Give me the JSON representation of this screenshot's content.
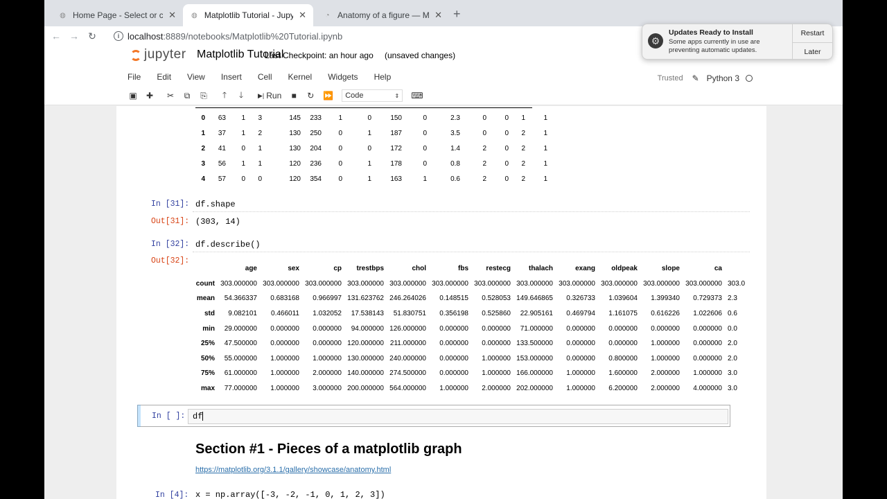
{
  "browser": {
    "tabs": [
      {
        "label": "Home Page - Select or create",
        "favicon": "jupyter-favicon"
      },
      {
        "label": "Matplotlib Tutorial - Jupyter N",
        "favicon": "jupyter-favicon"
      },
      {
        "label": "Anatomy of a figure — Matplo",
        "favicon": "matplotlib-favicon"
      }
    ],
    "new_tab": "+",
    "close_glyph": "✕",
    "url_host": "localhost",
    "url_rest": ":8889/notebooks/Matplotlib%20Tutorial.ipynb"
  },
  "jupyter": {
    "logo_text": "jupyter",
    "title": "Matplotlib Tutorial",
    "checkpoint": "Last Checkpoint: an hour ago",
    "unsaved": "(unsaved changes)",
    "menu": [
      "File",
      "Edit",
      "View",
      "Insert",
      "Cell",
      "Kernel",
      "Widgets",
      "Help"
    ],
    "trusted": "Trusted",
    "kernel": "Python 3",
    "run_label": "Run",
    "cell_type": "Code"
  },
  "notification": {
    "title": "Updates Ready to Install",
    "body": "Some apps currently in use are preventing automatic updates.",
    "restart": "Restart",
    "later": "Later"
  },
  "cells": {
    "head_table": {
      "rows": [
        [
          "0",
          "63",
          "1",
          "3",
          "145",
          "233",
          "1",
          "0",
          "150",
          "0",
          "2.3",
          "0",
          "0",
          "1",
          "1"
        ],
        [
          "1",
          "37",
          "1",
          "2",
          "130",
          "250",
          "0",
          "1",
          "187",
          "0",
          "3.5",
          "0",
          "0",
          "2",
          "1"
        ],
        [
          "2",
          "41",
          "0",
          "1",
          "130",
          "204",
          "0",
          "0",
          "172",
          "0",
          "1.4",
          "2",
          "0",
          "2",
          "1"
        ],
        [
          "3",
          "56",
          "1",
          "1",
          "120",
          "236",
          "0",
          "1",
          "178",
          "0",
          "0.8",
          "2",
          "0",
          "2",
          "1"
        ],
        [
          "4",
          "57",
          "0",
          "0",
          "120",
          "354",
          "0",
          "1",
          "163",
          "1",
          "0.6",
          "2",
          "0",
          "2",
          "1"
        ]
      ]
    },
    "shape_in": "In [31]:",
    "shape_code": "df.shape",
    "shape_out_prompt": "Out[31]:",
    "shape_out": "(303, 14)",
    "describe_in": "In [32]:",
    "describe_code": "df.describe()",
    "describe_out_prompt": "Out[32]:",
    "describe_table": {
      "columns": [
        "age",
        "sex",
        "cp",
        "trestbps",
        "chol",
        "fbs",
        "restecg",
        "thalach",
        "exang",
        "oldpeak",
        "slope",
        "ca",
        ""
      ],
      "rows": [
        {
          "label": "count",
          "values": [
            "303.000000",
            "303.000000",
            "303.000000",
            "303.000000",
            "303.000000",
            "303.000000",
            "303.000000",
            "303.000000",
            "303.000000",
            "303.000000",
            "303.000000",
            "303.000000",
            "303.0"
          ]
        },
        {
          "label": "mean",
          "values": [
            "54.366337",
            "0.683168",
            "0.966997",
            "131.623762",
            "246.264026",
            "0.148515",
            "0.528053",
            "149.646865",
            "0.326733",
            "1.039604",
            "1.399340",
            "0.729373",
            "2.3"
          ]
        },
        {
          "label": "std",
          "values": [
            "9.082101",
            "0.466011",
            "1.032052",
            "17.538143",
            "51.830751",
            "0.356198",
            "0.525860",
            "22.905161",
            "0.469794",
            "1.161075",
            "0.616226",
            "1.022606",
            "0.6"
          ]
        },
        {
          "label": "min",
          "values": [
            "29.000000",
            "0.000000",
            "0.000000",
            "94.000000",
            "126.000000",
            "0.000000",
            "0.000000",
            "71.000000",
            "0.000000",
            "0.000000",
            "0.000000",
            "0.000000",
            "0.0"
          ]
        },
        {
          "label": "25%",
          "values": [
            "47.500000",
            "0.000000",
            "0.000000",
            "120.000000",
            "211.000000",
            "0.000000",
            "0.000000",
            "133.500000",
            "0.000000",
            "0.000000",
            "1.000000",
            "0.000000",
            "2.0"
          ]
        },
        {
          "label": "50%",
          "values": [
            "55.000000",
            "1.000000",
            "1.000000",
            "130.000000",
            "240.000000",
            "0.000000",
            "1.000000",
            "153.000000",
            "0.000000",
            "0.800000",
            "1.000000",
            "0.000000",
            "2.0"
          ]
        },
        {
          "label": "75%",
          "values": [
            "61.000000",
            "1.000000",
            "2.000000",
            "140.000000",
            "274.500000",
            "0.000000",
            "1.000000",
            "166.000000",
            "1.000000",
            "1.600000",
            "2.000000",
            "1.000000",
            "3.0"
          ]
        },
        {
          "label": "max",
          "values": [
            "77.000000",
            "1.000000",
            "3.000000",
            "200.000000",
            "564.000000",
            "1.000000",
            "2.000000",
            "202.000000",
            "1.000000",
            "6.200000",
            "2.000000",
            "4.000000",
            "3.0"
          ]
        }
      ]
    },
    "active_in": "In [ ]:",
    "active_code": "df",
    "section_title": "Section #1 - Pieces of a matplotlib graph",
    "section_link": "https://matplotlib.org/3.1.1/gallery/showcase/anatomy.html",
    "array_in": "In [4]:",
    "array_code": "x = np.array([-3, -2, -1, 0, 1, 2, 3])"
  }
}
